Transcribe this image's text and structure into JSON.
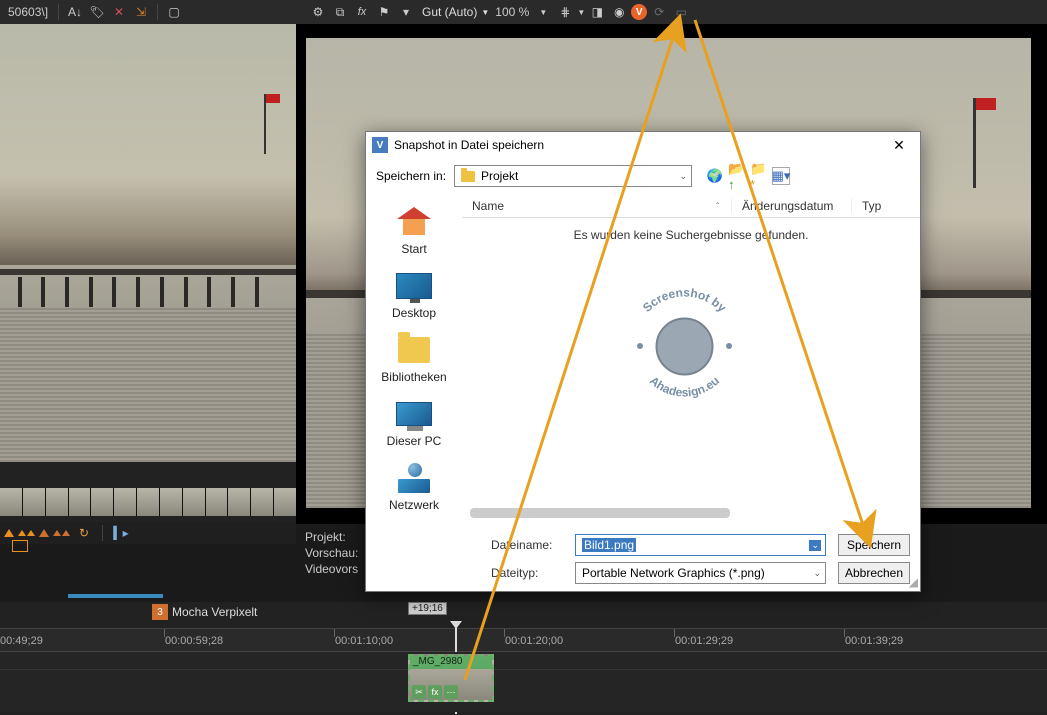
{
  "top": {
    "title_fragment": "50603\\]",
    "quality_label": "Gut (Auto)",
    "zoom": "100 %"
  },
  "info": {
    "row1": "Projekt:",
    "row2": "Vorschau:",
    "row3": "Videovors"
  },
  "dialog": {
    "title": "Snapshot in Datei speichern",
    "save_in_label": "Speichern in:",
    "folder": "Projekt",
    "nav": {
      "start": "Start",
      "desktop": "Desktop",
      "libs": "Bibliotheken",
      "pc": "Dieser PC",
      "net": "Netzwerk"
    },
    "cols": {
      "name": "Name",
      "date": "Änderungsdatum",
      "type": "Typ"
    },
    "empty": "Es wurden keine Suchergebnisse gefunden.",
    "filename_label": "Dateiname:",
    "filename": "Bild1.png",
    "filetype_label": "Dateityp:",
    "filetype": "Portable Network Graphics (*.png)",
    "save_btn": "Speichern",
    "cancel_btn": "Abbrechen"
  },
  "timeline": {
    "marker_num": "3",
    "marker_text": "Mocha Verpixelt",
    "offset_box": "+19;16",
    "ticks": [
      "00:49;29",
      "00:00:59;28",
      "00:01:10;00",
      "00:01:20;00",
      "00:01:29;29",
      "00:01:39;29"
    ],
    "clip_name": "_MG_2980"
  },
  "watermark": {
    "top": "Screenshot by",
    "bottom": "Ahadesign.eu"
  }
}
